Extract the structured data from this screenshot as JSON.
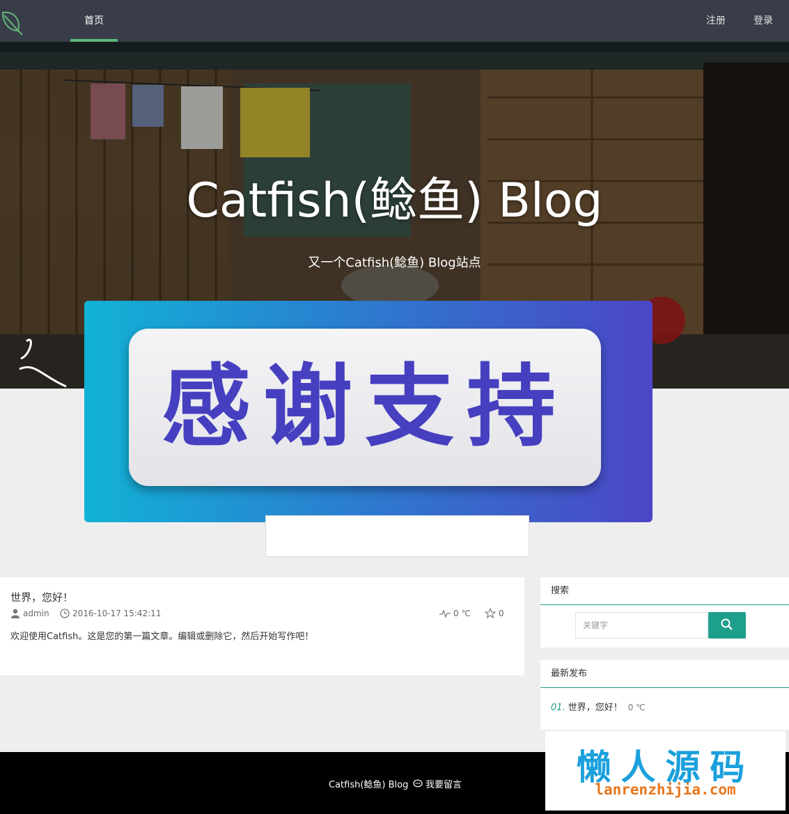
{
  "nav": {
    "home_label": "首页",
    "register_label": "注册",
    "login_label": "登录"
  },
  "hero": {
    "title": "Catfish(鲶鱼) Blog",
    "subtitle": "又一个Catfish(鲶鱼) Blog站点"
  },
  "banner": {
    "text": "感谢支持"
  },
  "article": {
    "title": "世界，您好！",
    "author": "admin",
    "date": "2016-10-17 15:42:11",
    "temperature": "0 ℃",
    "stars": "0",
    "excerpt": "欢迎使用Catfish。这是您的第一篇文章。编辑或删除它，然后开始写作吧！"
  },
  "sidebar": {
    "search_title": "搜索",
    "search_placeholder": "关键字",
    "latest_title": "最新发布",
    "latest_items": [
      {
        "num": "01.",
        "title": "世界，您好！",
        "temp": "0 ℃"
      }
    ]
  },
  "footer": {
    "site_name": "Catfish(鲶鱼) Blog",
    "message_link": "我要留言"
  },
  "watermark": {
    "main": "懒人源码",
    "sub": "lanrenzhijia.com"
  },
  "colors": {
    "nav_bg": "#393d49",
    "nav_active": "#5fb878",
    "accent": "#1e9e8c",
    "banner_text": "#4640c0"
  }
}
